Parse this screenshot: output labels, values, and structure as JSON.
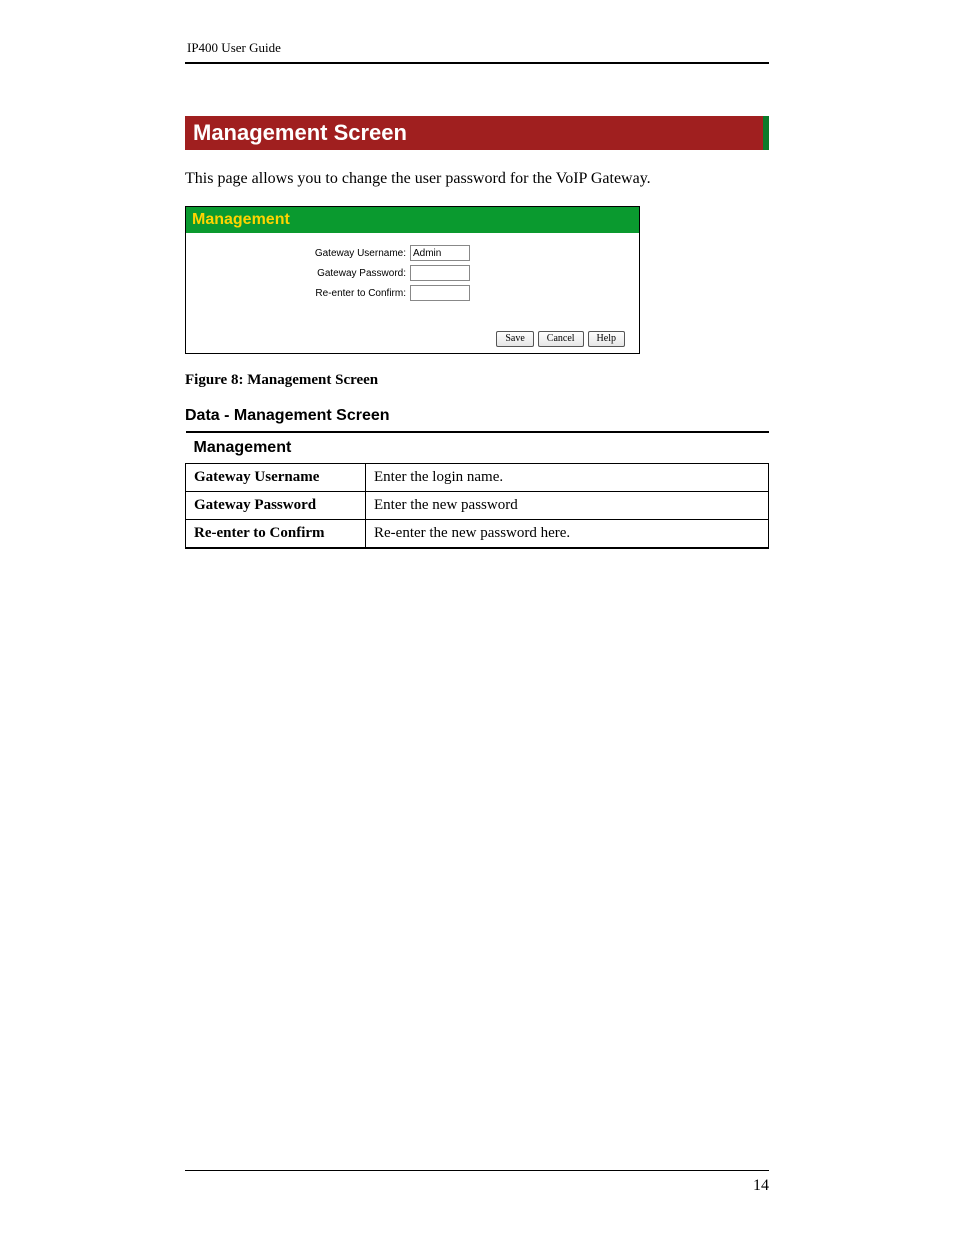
{
  "header": {
    "title": "IP400 User Guide"
  },
  "section": {
    "title": "Management Screen",
    "intro": "This page allows you to change the user password for the VoIP Gateway."
  },
  "screenshot": {
    "title": "Management",
    "fields": {
      "username_label": "Gateway Username:",
      "username_value": "Admin",
      "password_label": "Gateway Password:",
      "password_value": "",
      "confirm_label": "Re-enter to Confirm:",
      "confirm_value": ""
    },
    "buttons": {
      "save": "Save",
      "cancel": "Cancel",
      "help": "Help"
    }
  },
  "caption": "Figure 8: Management Screen",
  "data_section": {
    "heading": "Data - Management Screen",
    "group": "Management",
    "rows": [
      {
        "key": "Gateway Username",
        "val": "Enter the login name."
      },
      {
        "key": "Gateway Password",
        "val": "Enter the new password"
      },
      {
        "key": "Re-enter to Confirm",
        "val": "Re-enter the new password here."
      }
    ]
  },
  "footer": {
    "page_number": "14"
  }
}
